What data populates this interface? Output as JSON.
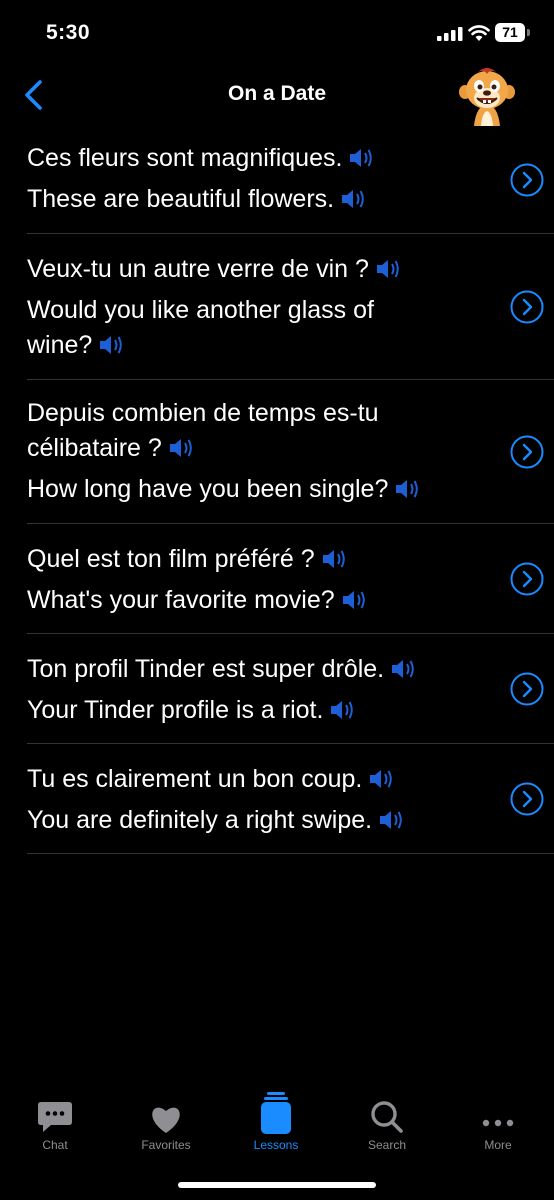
{
  "status_bar": {
    "time": "5:30",
    "battery": "71"
  },
  "nav": {
    "title": "On a Date",
    "back_icon": "chevron-left-icon",
    "avatar": "meerkat-avatar"
  },
  "colors": {
    "accent": "#1a8cff",
    "speaker": "#1f5fd6",
    "separator": "#333333",
    "inactive": "#8e8e93"
  },
  "phrases": [
    {
      "fr": "Ces fleurs sont magnifiques.",
      "en": "These are beautiful flowers."
    },
    {
      "fr": "Veux-tu un autre verre de vin ?",
      "en": "Would you like another glass of wine?"
    },
    {
      "fr": "Depuis combien de temps es-tu célibataire ?",
      "en": "How long have you been single?"
    },
    {
      "fr": "Quel est ton film préféré ?",
      "en": "What's your favorite movie?"
    },
    {
      "fr": "Ton profil Tinder est super drôle.",
      "en": "Your Tinder profile is a riot."
    },
    {
      "fr": "Tu es clairement un bon coup.",
      "en": "You are definitely a right swipe."
    }
  ],
  "tabs": [
    {
      "label": "Chat",
      "icon": "chat-bubble-icon"
    },
    {
      "label": "Favorites",
      "icon": "heart-icon"
    },
    {
      "label": "Lessons",
      "icon": "lessons-stack-icon",
      "active": true
    },
    {
      "label": "Search",
      "icon": "search-icon"
    },
    {
      "label": "More",
      "icon": "more-dots-icon"
    }
  ]
}
